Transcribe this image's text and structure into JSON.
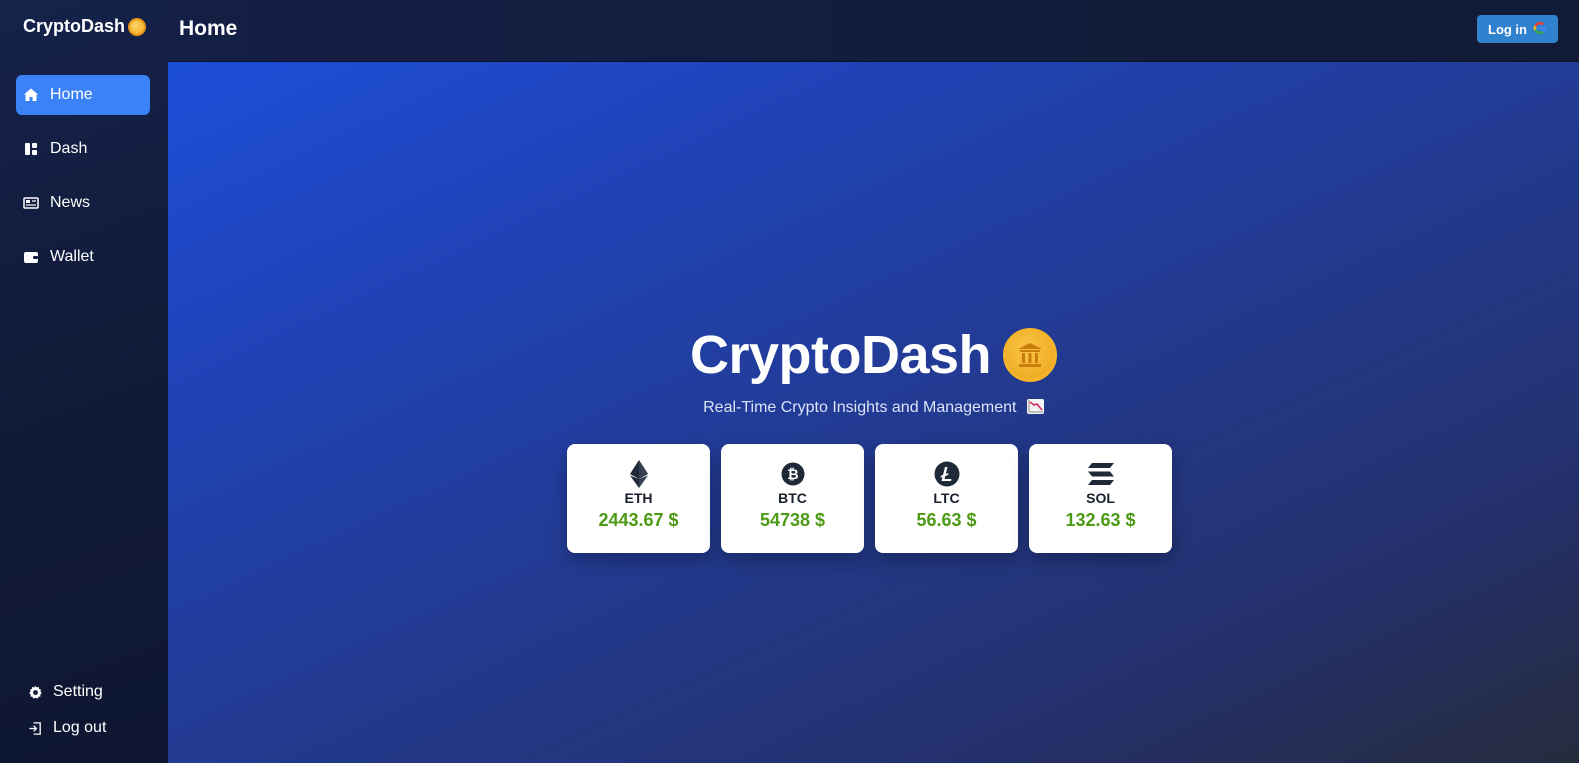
{
  "app": {
    "brand": "CryptoDash",
    "coin_icon": "coin-icon"
  },
  "sidebar": {
    "items": [
      {
        "label": "Home",
        "icon": "home-icon",
        "active": true
      },
      {
        "label": "Dash",
        "icon": "dashboard-icon",
        "active": false
      },
      {
        "label": "News",
        "icon": "newspaper-icon",
        "active": false
      },
      {
        "label": "Wallet",
        "icon": "wallet-icon",
        "active": false
      }
    ],
    "bottom": [
      {
        "label": "Setting",
        "icon": "gear-icon"
      },
      {
        "label": "Log out",
        "icon": "logout-icon"
      }
    ]
  },
  "header": {
    "title": "Home",
    "login_label": "Log in",
    "login_icon": "google-icon"
  },
  "hero": {
    "title": "CryptoDash",
    "title_icon": "bank-coin-icon",
    "subtitle": "Real-Time Crypto Insights and Management",
    "subtitle_icon": "chart-decreasing-icon"
  },
  "prices": [
    {
      "symbol": "ETH",
      "price": "2443.67 $",
      "icon": "ethereum-icon"
    },
    {
      "symbol": "BTC",
      "price": "54738 $",
      "icon": "bitcoin-icon"
    },
    {
      "symbol": "LTC",
      "price": "56.63 $",
      "icon": "litecoin-icon"
    },
    {
      "symbol": "SOL",
      "price": "132.63 $",
      "icon": "solana-icon"
    }
  ],
  "colors": {
    "accent": "#3b82f6",
    "login_button": "#3182ce",
    "price_text": "#4d9a14",
    "coin_gold": "#f5b42a"
  }
}
